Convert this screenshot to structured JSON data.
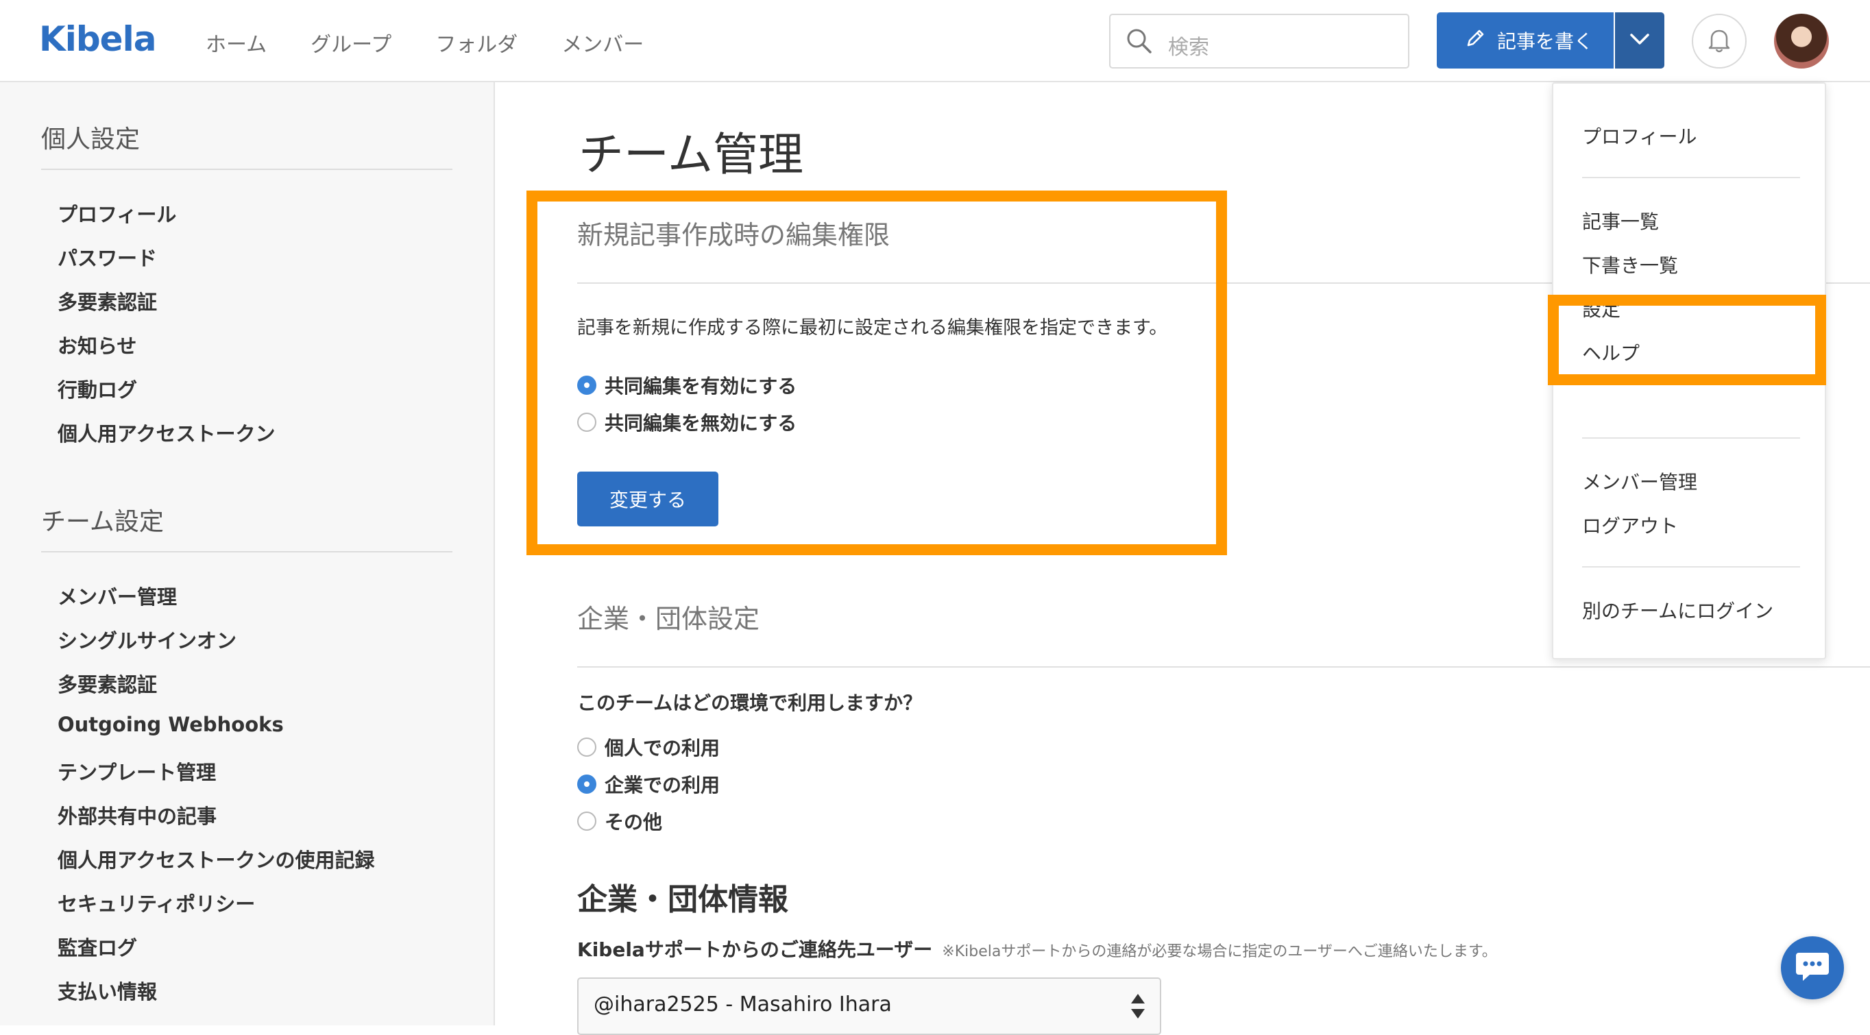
{
  "header": {
    "logo": "Kibela",
    "nav": [
      "ホーム",
      "グループ",
      "フォルダ",
      "メンバー"
    ],
    "search_placeholder": "検索",
    "write_label": "記事を書く"
  },
  "sidebar": {
    "personal_heading": "個人設定",
    "personal_items": [
      "プロフィール",
      "パスワード",
      "多要素認証",
      "お知らせ",
      "行動ログ",
      "個人用アクセストークン"
    ],
    "team_heading": "チーム設定",
    "team_items": [
      "メンバー管理",
      "シングルサインオン",
      "多要素認証",
      "Outgoing Webhooks",
      "テンプレート管理",
      "外部共有中の記事",
      "個人用アクセストークンの使用記録",
      "セキュリティポリシー",
      "監査ログ",
      "支払い情報"
    ]
  },
  "main": {
    "title": "チーム管理",
    "edit_section": {
      "title": "新規記事作成時の編集権限",
      "description": "記事を新規に作成する際に最初に設定される編集権限を指定できます。",
      "options": [
        "共同編集を有効にする",
        "共同編集を無効にする"
      ],
      "selected": 0,
      "button": "変更する"
    },
    "org_section": {
      "title": "企業・団体設定",
      "question": "このチームはどの環境で利用しますか？",
      "options": [
        "個人での利用",
        "企業での利用",
        "その他"
      ],
      "selected": 1
    },
    "org_info": {
      "title": "企業・団体情報",
      "contact_label": "Kibelaサポートからのご連絡先ユーザー",
      "contact_note": "※Kibelaサポートからの連絡が必要な場合に指定のユーザーへご連絡いたします。",
      "contact_value": "@ihara2525 - Masahiro Ihara"
    }
  },
  "menu": {
    "items": [
      "プロフィール",
      "記事一覧",
      "下書き一覧",
      "設定",
      "ヘルプ",
      "メンバー管理",
      "ログアウト",
      "別のチームにログイン"
    ]
  },
  "colors": {
    "brand": "#2d6fc2",
    "highlight": "#ff9800"
  }
}
